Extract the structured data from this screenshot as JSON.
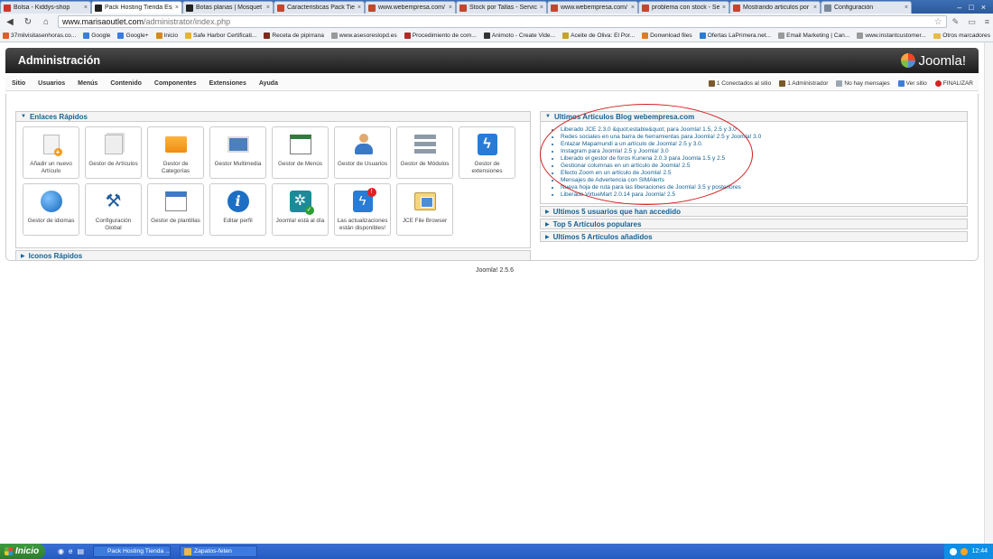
{
  "browser": {
    "tabs": [
      {
        "title": "Bolsa - Kiddys-shop",
        "active": false,
        "icon": "kiddys-favicon",
        "color": "#d0342c"
      },
      {
        "title": "Pack Hosting Tienda Esp",
        "active": true,
        "icon": "wordpress-favicon",
        "color": "#222222"
      },
      {
        "title": "Botas planas | Mosquet",
        "active": false,
        "icon": "wordpress-favicon",
        "color": "#222222"
      },
      {
        "title": "Caracteristicas Pack Tien",
        "active": false,
        "icon": "webempresa-favicon",
        "color": "#c2472f"
      },
      {
        "title": "www.webempresa.com/",
        "active": false,
        "icon": "webempresa-favicon",
        "color": "#c2472f"
      },
      {
        "title": "Stock por Tallas - Servic",
        "active": false,
        "icon": "webempresa-favicon",
        "color": "#c2472f"
      },
      {
        "title": "www.webempresa.com/",
        "active": false,
        "icon": "webempresa-favicon",
        "color": "#c2472f"
      },
      {
        "title": "problema con stock - Se",
        "active": false,
        "icon": "webempresa-favicon",
        "color": "#c2472f"
      },
      {
        "title": "Mostrando articulos por c",
        "active": false,
        "icon": "webempresa-favicon",
        "color": "#c2472f"
      },
      {
        "title": "Configuración",
        "active": false,
        "icon": "wrench-favicon",
        "color": "#7a8899"
      }
    ],
    "tab_close": "×",
    "window_controls": [
      "–",
      "□",
      "×"
    ],
    "url_host": "www.marisaoutlet.com",
    "url_path": "/administrator/index.php",
    "bookmarks": [
      {
        "label": "37milvisitasenhoras.co...",
        "color": "#e15c2a"
      },
      {
        "label": "Google",
        "color": "#3b7dd8"
      },
      {
        "label": "Google+",
        "color": "#3b7dd8"
      },
      {
        "label": "Inicio",
        "color": "#d48a1e"
      },
      {
        "label": "Safe Harbor Certificati...",
        "color": "#e5b531"
      },
      {
        "label": "Receta de pipirrana",
        "color": "#7a2c1c"
      },
      {
        "label": "www.asesoreslopd.es",
        "color": "#999999"
      },
      {
        "label": "Procedimiento de com...",
        "color": "#b02a2a"
      },
      {
        "label": "Animoto - Create Vide...",
        "color": "#333333"
      },
      {
        "label": "Aceite de Oliva: El Por...",
        "color": "#c6a32a"
      },
      {
        "label": "Donwnload files",
        "color": "#e07b20"
      },
      {
        "label": "Ofertas LaPrimera.net...",
        "color": "#2a7bd6"
      },
      {
        "label": "Email Marketing | Can...",
        "color": "#999999"
      },
      {
        "label": "www.instantcustomer...",
        "color": "#999999"
      }
    ],
    "other_bookmarks": "Otros marcadores"
  },
  "joomla": {
    "title": "Administración",
    "logo_text": "Joomla!",
    "menu": [
      "Sitio",
      "Usuarios",
      "Menús",
      "Contenido",
      "Componentes",
      "Extensiones",
      "Ayuda"
    ],
    "status": [
      {
        "label": "1 Conectados al sitio",
        "icon": "users-online-icon",
        "color": "#7b5a2a"
      },
      {
        "label": "1 Administrador",
        "icon": "admin-icon",
        "color": "#7b5a2a"
      },
      {
        "label": "No hay mensajes",
        "icon": "messages-icon",
        "color": "#9aa7b3"
      },
      {
        "label": "Ver sitio",
        "icon": "view-site-icon",
        "color": "#3b7dd8"
      },
      {
        "label": "FINALIZAR",
        "icon": "logout-icon",
        "color": "#d22222"
      }
    ],
    "quick_links_title": "Enlaces Rápidos",
    "quick_icons": [
      {
        "label": "Añadir un nuevo Artículo",
        "icon": "add-article-icon"
      },
      {
        "label": "Gestor de Artículos",
        "icon": "article-manager-icon"
      },
      {
        "label": "Gestor de Categorías",
        "icon": "category-manager-icon"
      },
      {
        "label": "Gestor Multimedia",
        "icon": "media-manager-icon"
      },
      {
        "label": "Gestor de Menús",
        "icon": "menu-manager-icon"
      },
      {
        "label": "Gestor de Usuarios",
        "icon": "user-manager-icon"
      },
      {
        "label": "Gestor de Módulos",
        "icon": "module-manager-icon"
      },
      {
        "label": "Gestor de extensiones",
        "icon": "extension-manager-icon"
      },
      {
        "label": "Gestor de idiomas",
        "icon": "language-manager-icon"
      },
      {
        "label": "Configuración Global",
        "icon": "global-config-icon"
      },
      {
        "label": "Gestor de plantillas",
        "icon": "template-manager-icon"
      },
      {
        "label": "Editar perfil",
        "icon": "edit-profile-icon"
      },
      {
        "label": "Joomla! está al día",
        "icon": "joomla-uptodate-icon"
      },
      {
        "label": "Las actualizaciones están disponibles!",
        "icon": "updates-available-icon"
      },
      {
        "label": "JCE File Browser",
        "icon": "jce-file-browser-icon"
      }
    ],
    "quick_icons_title": "Iconos Rápidos",
    "blog_title": "Ultimos Articulos Blog webempresa.com",
    "blog_items": [
      "Liberado JCE 2.3.0 &quot;estable&quot; para Joomla! 1.5, 2.5 y 3.0",
      "Redes sociales en una barra de herramientas para Joomla! 2.5 y Joomla! 3.0",
      "Enlazar Mapamundi a un artículo de Joomla! 2.5 y 3.0.",
      "Instagram para Joomla! 2.5 y Joomla! 3.0",
      "Liberado el gestor de foros Kunena 2.0.3 para Joomla 1.5 y 2.5",
      "Gestionar columnas en un artículo de Joomla! 2.5",
      "Efecto Zoom en un artículo de Joomla! 2.5",
      "Mensajes de Advertencia con SIMAlerts",
      "Nueva hoja de ruta para las liberaciones de Joomla! 3.5 y posteriores",
      "Liberado VirtueMart 2.0.14 para Joomla! 2.5"
    ],
    "collapsed_sections": [
      "Ultimos 5 usuarios que han accedido",
      "Top 5 Artículos populares",
      "Ultimos 5 Artículos añadidos"
    ],
    "version": "Joomla! 2.5.6"
  },
  "taskbar": {
    "start": "Inicio",
    "items": [
      {
        "label": "Pack Hosting Tienda ...",
        "color": "#3b7dd8"
      },
      {
        "label": "Zapatos-feten",
        "color": "#e8b94b"
      }
    ],
    "clock": "12:44"
  },
  "colors": {
    "joomla_link": "#146295",
    "annotation_red": "#d02020",
    "taskbar_blue": "#245bc2"
  }
}
